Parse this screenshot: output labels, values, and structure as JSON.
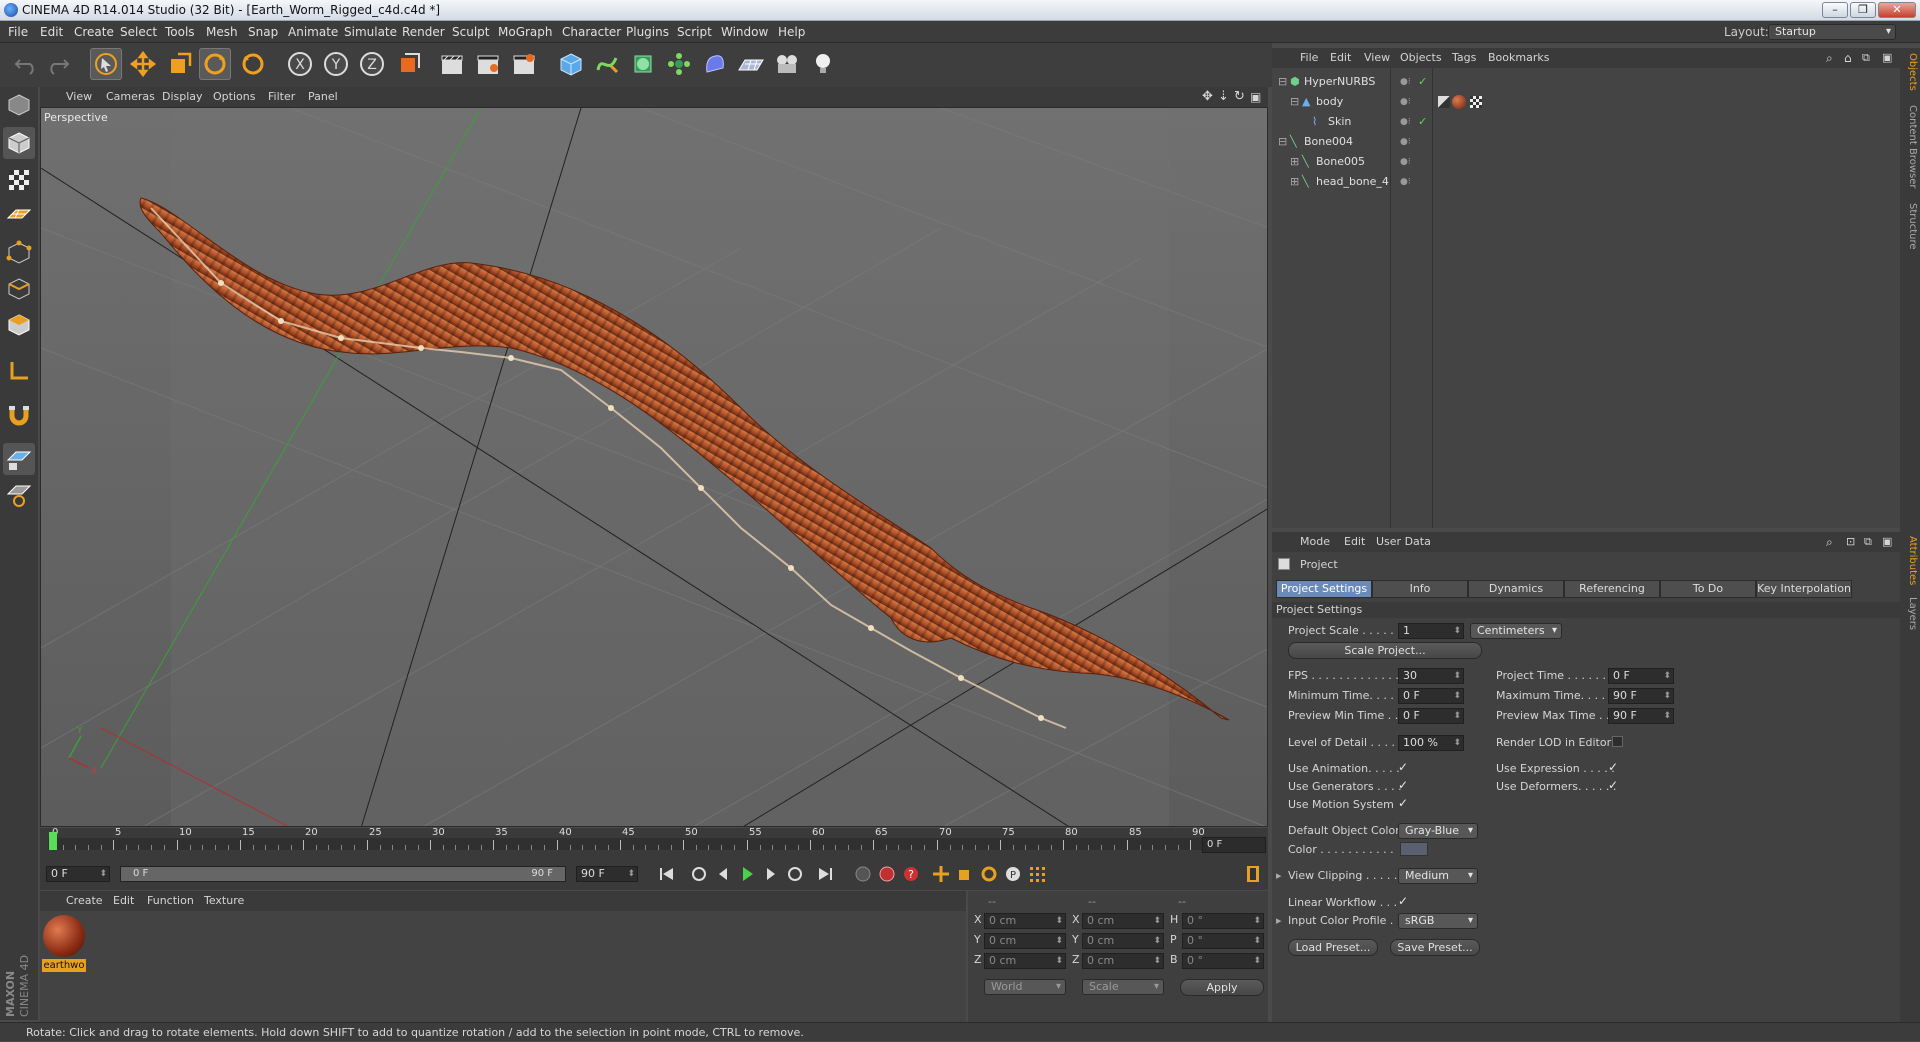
{
  "window": {
    "title": "CINEMA 4D R14.014 Studio (32 Bit) - [Earth_Worm_Rigged_c4d.c4d *]",
    "layout_label": "Layout:",
    "layout_value": "Startup"
  },
  "menu": [
    "File",
    "Edit",
    "Create",
    "Select",
    "Tools",
    "Mesh",
    "Snap",
    "Animate",
    "Simulate",
    "Render",
    "Sculpt",
    "MoGraph",
    "Character",
    "Plugins",
    "Script",
    "Window",
    "Help"
  ],
  "viewport": {
    "menu": [
      "View",
      "Cameras",
      "Display",
      "Options",
      "Filter",
      "Panel"
    ],
    "label": "Perspective",
    "axis": {
      "x": "X",
      "y": "Y"
    }
  },
  "timeline": {
    "ticks": [
      "0",
      "5",
      "10",
      "15",
      "20",
      "25",
      "30",
      "35",
      "40",
      "45",
      "50",
      "55",
      "60",
      "65",
      "70",
      "75",
      "80",
      "85",
      "90"
    ],
    "current_frame": "0 F",
    "start": "0 F",
    "range_start": "0 F",
    "range_end": "90 F",
    "end": "90 F"
  },
  "material": {
    "menu": [
      "Create",
      "Edit",
      "Function",
      "Texture"
    ],
    "items": [
      {
        "name": "earthwo"
      }
    ]
  },
  "coords": {
    "headers": [
      "--",
      "--",
      "--"
    ],
    "rows": [
      {
        "a": "X",
        "av": "0 cm",
        "b": "X",
        "bv": "0 cm",
        "c": "H",
        "cv": "0 °"
      },
      {
        "a": "Y",
        "av": "0 cm",
        "b": "Y",
        "bv": "0 cm",
        "c": "P",
        "cv": "0 °"
      },
      {
        "a": "Z",
        "av": "0 cm",
        "b": "Z",
        "bv": "0 cm",
        "c": "B",
        "cv": "0 °"
      }
    ],
    "space": "World",
    "mode": "Scale",
    "apply": "Apply"
  },
  "status": "Rotate: Click and drag to rotate elements. Hold down SHIFT to add to quantize rotation / add to the selection in point mode, CTRL to remove.",
  "objects": {
    "menu": [
      "File",
      "Edit",
      "View",
      "Objects",
      "Tags",
      "Bookmarks"
    ],
    "tree": [
      {
        "name": "HyperNURBS"
      },
      {
        "name": "body"
      },
      {
        "name": "Skin"
      },
      {
        "name": "Bone004"
      },
      {
        "name": "Bone005"
      },
      {
        "name": "head_bone_4"
      }
    ]
  },
  "attributes": {
    "menu": [
      "Mode",
      "Edit",
      "User Data"
    ],
    "object": "Project",
    "tabs": [
      "Project Settings",
      "Info",
      "Dynamics",
      "Referencing",
      "To Do",
      "Key Interpolation"
    ],
    "section": "Project Settings",
    "project_scale_label": "Project Scale . . . . . .",
    "project_scale_value": "1",
    "project_scale_unit": "Centimeters",
    "scale_project_btn": "Scale Project...",
    "fps_label": "FPS . . . . . . . . . . . . . .",
    "fps": "30",
    "project_time_label": "Project Time . . . . . . . .",
    "project_time": "0 F",
    "min_time_label": "Minimum Time. . . . . .",
    "min_time": "0 F",
    "max_time_label": "Maximum Time. . . . . .",
    "max_time": "90 F",
    "preview_min_label": "Preview Min Time . .",
    "preview_min": "0 F",
    "preview_max_label": "Preview Max Time . . .",
    "preview_max": "90 F",
    "lod_label": "Level of Detail . . . . .",
    "lod": "100 %",
    "render_lod_label": "Render LOD in Editor",
    "use_animation_label": "Use Animation. . . . .",
    "use_expression_label": "Use Expression . . . . .",
    "use_generators_label": "Use Generators . . . .",
    "use_deformers_label": "Use Deformers. . . . . .",
    "use_motion_label": "Use Motion System",
    "default_color_label": "Default Object Color",
    "default_color": "Gray-Blue",
    "color_label": "Color . . . . . . . . . . .",
    "view_clipping_label": "View Clipping . . . . .",
    "view_clipping": "Medium",
    "linear_workflow_label": "Linear Workflow . . .",
    "input_profile_label": "Input Color Profile . .",
    "input_profile": "sRGB",
    "load_preset": "Load Preset...",
    "save_preset": "Save Preset..."
  },
  "sidetabs": {
    "top": [
      "Objects",
      "Content Browser",
      "Structure"
    ],
    "bottom": [
      "Attributes",
      "Layers"
    ]
  },
  "brand": {
    "line1": "MAXON",
    "line2": "CINEMA 4D"
  },
  "colors": {
    "accent_orange": "#f0a020",
    "selected_tab": "#6a8bb8",
    "worm": "#b5532a"
  }
}
